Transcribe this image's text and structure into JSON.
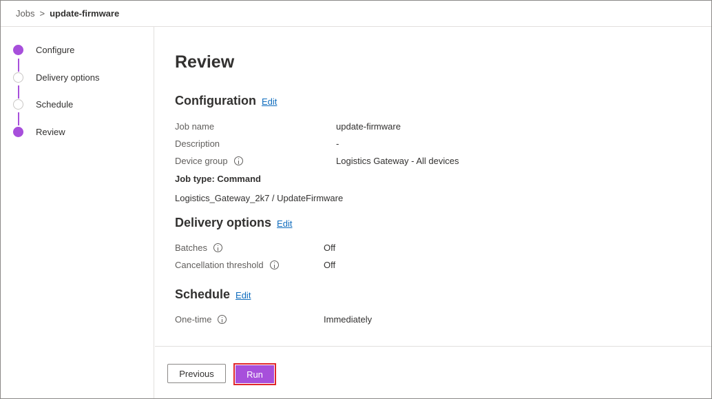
{
  "breadcrumb": {
    "parent": "Jobs",
    "separator": ">",
    "current": "update-firmware"
  },
  "steps": [
    {
      "label": "Configure",
      "state": "done"
    },
    {
      "label": "Delivery options",
      "state": "todo"
    },
    {
      "label": "Schedule",
      "state": "todo"
    },
    {
      "label": "Review",
      "state": "current"
    }
  ],
  "review": {
    "title": "Review",
    "configuration": {
      "title": "Configuration",
      "edit": "Edit",
      "job_name_label": "Job name",
      "job_name_value": "update-firmware",
      "description_label": "Description",
      "description_value": "-",
      "device_group_label": "Device group",
      "device_group_value": "Logistics Gateway - All devices",
      "job_type": "Job type: Command",
      "command": "Logistics_Gateway_2k7 / UpdateFirmware"
    },
    "delivery": {
      "title": "Delivery options",
      "edit": "Edit",
      "batches_label": "Batches",
      "batches_value": "Off",
      "cancel_label": "Cancellation threshold",
      "cancel_value": "Off"
    },
    "schedule": {
      "title": "Schedule",
      "edit": "Edit",
      "onetime_label": "One-time",
      "onetime_value": "Immediately"
    }
  },
  "footer": {
    "previous": "Previous",
    "run": "Run"
  },
  "colors": {
    "accent": "#a74fdb",
    "link": "#0f6cbd",
    "highlight": "#e0262a"
  }
}
